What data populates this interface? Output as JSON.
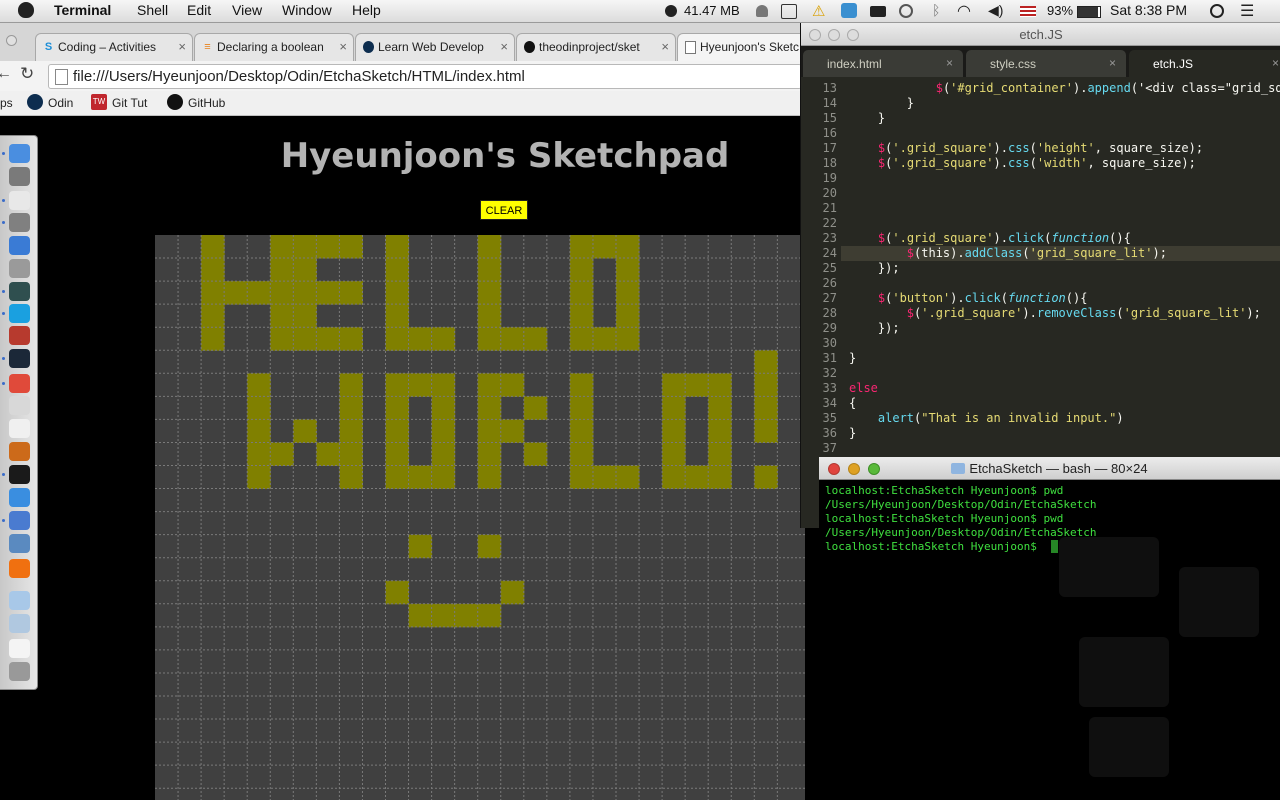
{
  "menubar": {
    "app_name": "Terminal",
    "items": [
      "Shell",
      "Edit",
      "View",
      "Window",
      "Help"
    ],
    "memory": "41.47 MB",
    "battery": "93%",
    "clock": "Sat 8:38 PM"
  },
  "browser": {
    "tabs": [
      {
        "label": "Coding – Activities",
        "icon": "skype-icon"
      },
      {
        "label": "Declaring a boolean",
        "icon": "stackoverflow-icon"
      },
      {
        "label": "Learn Web Develop",
        "icon": "odin-icon"
      },
      {
        "label": "theodinproject/sket",
        "icon": "github-icon"
      },
      {
        "label": "Hyeunjoon's Sketc",
        "icon": "document-icon"
      }
    ],
    "url": "file:///Users/Hyeunjoon/Desktop/Odin/EtchaSketch/HTML/index.html",
    "bookmarks": [
      {
        "label": "ps",
        "icon": "none"
      },
      {
        "label": "Odin",
        "icon": "odin-icon"
      },
      {
        "label": "Git Tut",
        "icon": "tw-icon"
      },
      {
        "label": "GitHub",
        "icon": "github-icon"
      }
    ]
  },
  "page": {
    "title": "Hyeunjoon's Sketchpad",
    "clear_label": "CLEAR",
    "grid_color": "#404040",
    "lit_color": "#808000"
  },
  "editor": {
    "window_title": "etch.JS",
    "tabs": [
      "index.html",
      "style.css",
      "etch.JS"
    ],
    "active_tab": "etch.JS",
    "current_line": 24,
    "lines": [
      {
        "n": 13,
        "code": "            $('#grid_container').append('<div class=\"grid_squa"
      },
      {
        "n": 14,
        "code": "        }"
      },
      {
        "n": 15,
        "code": "    }"
      },
      {
        "n": 16,
        "code": ""
      },
      {
        "n": 17,
        "code": "    $('.grid_square').css('height', square_size);"
      },
      {
        "n": 18,
        "code": "    $('.grid_square').css('width', square_size);"
      },
      {
        "n": 19,
        "code": ""
      },
      {
        "n": 20,
        "code": ""
      },
      {
        "n": 21,
        "code": ""
      },
      {
        "n": 22,
        "code": ""
      },
      {
        "n": 23,
        "code": "    $('.grid_square').click(function(){"
      },
      {
        "n": 24,
        "code": "        $(this).addClass('grid_square_lit');"
      },
      {
        "n": 25,
        "code": "    });"
      },
      {
        "n": 26,
        "code": ""
      },
      {
        "n": 27,
        "code": "    $('button').click(function(){"
      },
      {
        "n": 28,
        "code": "        $('.grid_square').removeClass('grid_square_lit');"
      },
      {
        "n": 29,
        "code": "    });"
      },
      {
        "n": 30,
        "code": ""
      },
      {
        "n": 31,
        "code": "}"
      },
      {
        "n": 32,
        "code": ""
      },
      {
        "n": 33,
        "code": "else"
      },
      {
        "n": 34,
        "code": "{"
      },
      {
        "n": 35,
        "code": "    alert(\"That is an invalid input.\")"
      },
      {
        "n": 36,
        "code": "}"
      },
      {
        "n": 37,
        "code": ""
      }
    ]
  },
  "terminal": {
    "window_title": "EtchaSketch — bash — 80×24",
    "lines": [
      "localhost:EtchaSketch Hyeunjoon$ pwd",
      "/Users/Hyeunjoon/Desktop/Odin/EtchaSketch",
      "localhost:EtchaSketch Hyeunjoon$ pwd",
      "/Users/Hyeunjoon/Desktop/Odin/EtchaSketch",
      "localhost:EtchaSketch Hyeunjoon$"
    ]
  },
  "dock": {
    "icons": [
      "finder-icon",
      "mail-icon",
      "calendar-icon",
      "system-preferences-icon",
      "word-icon",
      "printer-icon",
      "activity-monitor-icon",
      "skype-icon",
      "filezilla-icon",
      "lightroom-icon",
      "chrome-icon",
      "preview-icon",
      "j-app-icon",
      "sublime-icon",
      "terminal-icon",
      "app-store-icon",
      "xcode-icon",
      "photo-icon",
      "vlc-icon",
      "folder-icon",
      "documents-folder-icon",
      "file-icon",
      "trash-icon"
    ]
  }
}
